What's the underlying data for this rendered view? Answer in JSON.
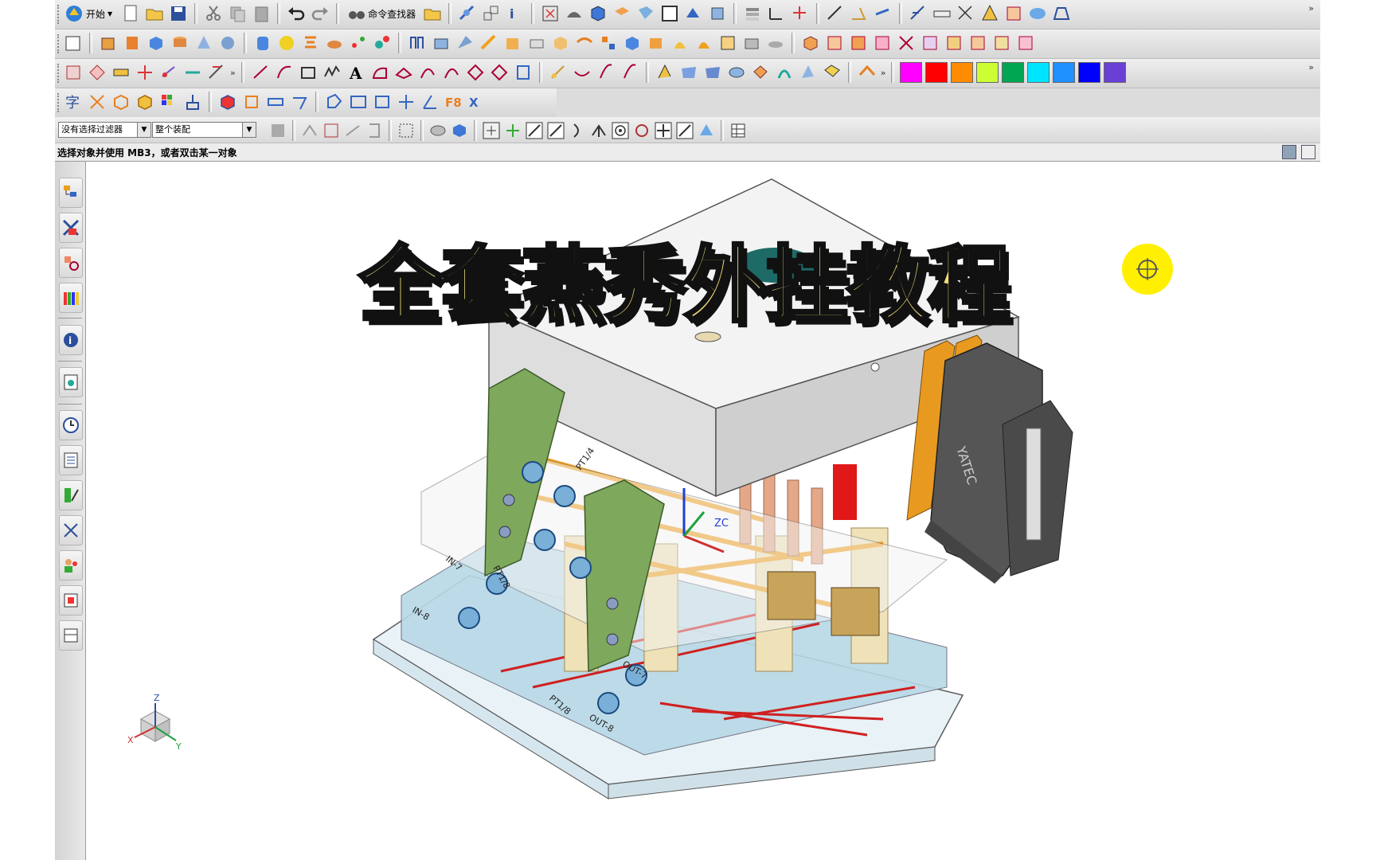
{
  "toolbar": {
    "start_label": "开始",
    "command_finder_label": "命令查找器"
  },
  "selection_bar": {
    "filter_value": "没有选择过滤器",
    "scope_value": "整个装配"
  },
  "status": {
    "prompt": "选择对象并使用 MB3，或者双击某一对象"
  },
  "viewport": {
    "overlay_title": "全套燕秀外挂教程",
    "axis_zc_label": "ZC",
    "triad": {
      "x": "X",
      "y": "Y",
      "z": "Z"
    },
    "connector_brand": "YATEC",
    "port_labels": [
      "PT1/4",
      "PT1/8",
      "IN-7",
      "IN-8",
      "OUT-7",
      "OUT-8",
      "PT1/8"
    ]
  },
  "colors": {
    "swatches": [
      "#ff00ff",
      "#ff0000",
      "#ff8c00",
      "#ccff33",
      "#00a651",
      "#00e5ff",
      "#1e90ff",
      "#0000ff",
      "#6a3fd6"
    ],
    "title_fill": "#f2e07a",
    "cursor_highlight": "#ffef00"
  }
}
